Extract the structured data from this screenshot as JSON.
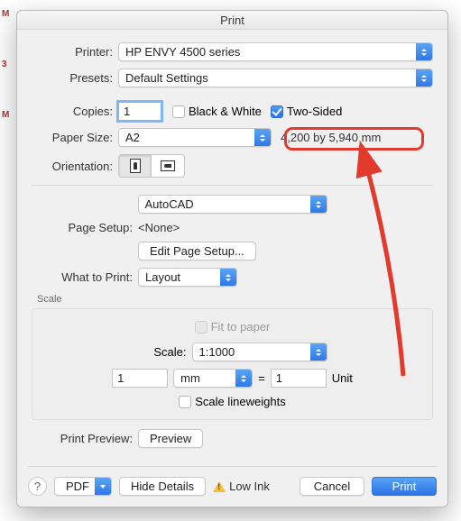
{
  "title": "Print",
  "printer": {
    "label": "Printer:",
    "value": "HP ENVY 4500 series"
  },
  "presets": {
    "label": "Presets:",
    "value": "Default Settings"
  },
  "copies": {
    "label": "Copies:",
    "value": "1",
    "bw_label": "Black & White",
    "twosided_label": "Two-Sided"
  },
  "paper": {
    "label": "Paper Size:",
    "value": "A2",
    "dimensions": "4,200 by 5,940 mm"
  },
  "orientation": {
    "label": "Orientation:"
  },
  "section_select": "AutoCAD",
  "page_setup": {
    "label": "Page Setup:",
    "value": "<None>",
    "button": "Edit Page Setup..."
  },
  "what_to_print": {
    "label": "What to Print:",
    "value": "Layout"
  },
  "scale": {
    "title": "Scale",
    "fit_label": "Fit to paper",
    "scale_label": "Scale:",
    "scale_value": "1:1000",
    "left_value": "1",
    "unit_select": "mm",
    "equals": "=",
    "right_value": "1",
    "unit_label": "Unit",
    "lineweights_label": "Scale lineweights"
  },
  "preview": {
    "label": "Print Preview:",
    "button": "Preview"
  },
  "bottom": {
    "help": "?",
    "pdf": "PDF",
    "hide": "Hide Details",
    "lowink": "Low Ink",
    "cancel": "Cancel",
    "print": "Print"
  },
  "edge": {
    "a": "M",
    "b": "3",
    "c": "M"
  }
}
